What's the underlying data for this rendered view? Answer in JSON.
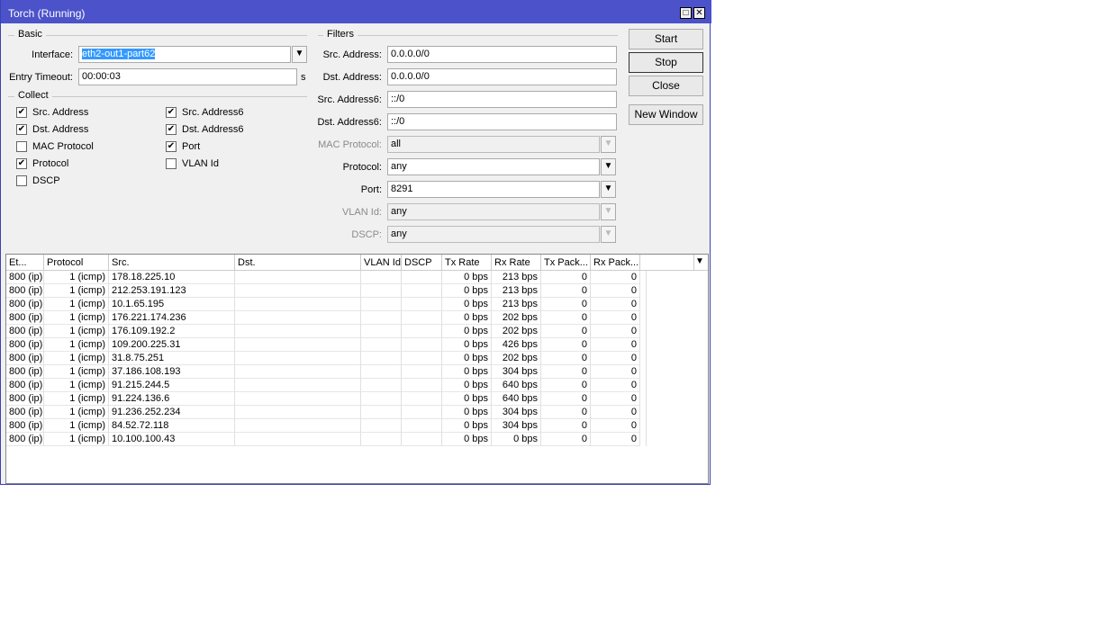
{
  "window": {
    "title": "Torch (Running)",
    "maximize": "□",
    "close": "✕"
  },
  "basic": {
    "label": "Basic",
    "interface_label": "Interface:",
    "interface_value": "eth2-out1-part62",
    "timeout_label": "Entry Timeout:",
    "timeout_value": "00:00:03",
    "timeout_unit": "s"
  },
  "collect": {
    "label": "Collect",
    "items": [
      {
        "label": "Src. Address",
        "checked": true
      },
      {
        "label": "Dst. Address",
        "checked": true
      },
      {
        "label": "MAC Protocol",
        "checked": false
      },
      {
        "label": "Protocol",
        "checked": true
      },
      {
        "label": "DSCP",
        "checked": false
      },
      {
        "label": "Src. Address6",
        "checked": true
      },
      {
        "label": "Dst. Address6",
        "checked": true
      },
      {
        "label": "Port",
        "checked": true
      },
      {
        "label": "VLAN Id",
        "checked": false
      }
    ]
  },
  "filters": {
    "label": "Filters",
    "fields": [
      {
        "label": "Src. Address:",
        "value": "0.0.0.0/0"
      },
      {
        "label": "Dst. Address:",
        "value": "0.0.0.0/0"
      },
      {
        "label": "Src. Address6:",
        "value": "::/0"
      },
      {
        "label": "Dst. Address6:",
        "value": "::/0"
      },
      {
        "label": "MAC Protocol:",
        "value": "all"
      },
      {
        "label": "Protocol:",
        "value": "any"
      },
      {
        "label": "Port:",
        "value": "8291"
      },
      {
        "label": "VLAN Id:",
        "value": "any"
      },
      {
        "label": "DSCP:",
        "value": "any"
      }
    ]
  },
  "buttons": {
    "start": "Start",
    "stop": "Stop",
    "close": "Close",
    "new_window": "New Window"
  },
  "table": {
    "columns": [
      "Et...",
      "Protocol",
      "Src.",
      "Dst.",
      "VLAN Id",
      "DSCP",
      "Tx Rate",
      "Rx Rate",
      "Tx Pack...",
      "Rx Pack..."
    ],
    "rows": [
      [
        "800 (ip)",
        "1 (icmp)",
        "178.18.225.10",
        "",
        "",
        "",
        "0 bps",
        "213 bps",
        "0",
        "0"
      ],
      [
        "800 (ip)",
        "1 (icmp)",
        "212.253.191.123",
        "",
        "",
        "",
        "0 bps",
        "213 bps",
        "0",
        "0"
      ],
      [
        "800 (ip)",
        "1 (icmp)",
        "10.1.65.195",
        "",
        "",
        "",
        "0 bps",
        "213 bps",
        "0",
        "0"
      ],
      [
        "800 (ip)",
        "1 (icmp)",
        "176.221.174.236",
        "",
        "",
        "",
        "0 bps",
        "202 bps",
        "0",
        "0"
      ],
      [
        "800 (ip)",
        "1 (icmp)",
        "176.109.192.2",
        "",
        "",
        "",
        "0 bps",
        "202 bps",
        "0",
        "0"
      ],
      [
        "800 (ip)",
        "1 (icmp)",
        "109.200.225.31",
        "",
        "",
        "",
        "0 bps",
        "426 bps",
        "0",
        "0"
      ],
      [
        "800 (ip)",
        "1 (icmp)",
        "31.8.75.251",
        "",
        "",
        "",
        "0 bps",
        "202 bps",
        "0",
        "0"
      ],
      [
        "800 (ip)",
        "1 (icmp)",
        "37.186.108.193",
        "",
        "",
        "",
        "0 bps",
        "304 bps",
        "0",
        "0"
      ],
      [
        "800 (ip)",
        "1 (icmp)",
        "91.215.244.5",
        "",
        "",
        "",
        "0 bps",
        "640 bps",
        "0",
        "0"
      ],
      [
        "800 (ip)",
        "1 (icmp)",
        "91.224.136.6",
        "",
        "",
        "",
        "0 bps",
        "640 bps",
        "0",
        "0"
      ],
      [
        "800 (ip)",
        "1 (icmp)",
        "91.236.252.234",
        "",
        "",
        "",
        "0 bps",
        "304 bps",
        "0",
        "0"
      ],
      [
        "800 (ip)",
        "1 (icmp)",
        "84.52.72.118",
        "",
        "",
        "",
        "0 bps",
        "304 bps",
        "0",
        "0"
      ],
      [
        "800 (ip)",
        "1 (icmp)",
        "10.100.100.43",
        "",
        "",
        "",
        "0 bps",
        "0 bps",
        "0",
        "0"
      ]
    ]
  }
}
